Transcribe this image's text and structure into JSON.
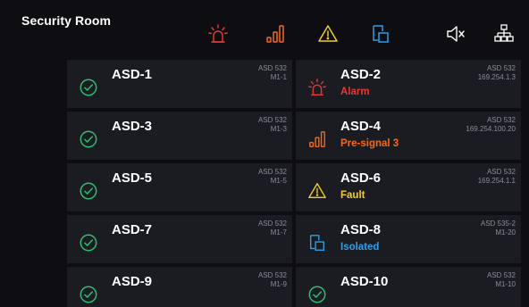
{
  "header": {
    "title": "Security Room",
    "icons": [
      {
        "name": "alarm-icon",
        "color": "#e53935"
      },
      {
        "name": "pre-signal-icon",
        "color": "#f26b1d"
      },
      {
        "name": "fault-icon",
        "color": "#f2d024"
      },
      {
        "name": "isolated-icon",
        "color": "#2f9fe8"
      },
      {
        "name": "mute-speaker-icon",
        "color": "#ffffff"
      },
      {
        "name": "network-icon",
        "color": "#ffffff"
      }
    ]
  },
  "colors": {
    "normal": "#2fbf71",
    "alarm": "#e53935",
    "presignal": "#f26b1d",
    "fault": "#f2d024",
    "isolated": "#2f9fe8"
  },
  "devices": [
    {
      "name": "ASD-1",
      "status": "",
      "status_kind": "normal",
      "model": "ASD 532",
      "address": "M1-1"
    },
    {
      "name": "ASD-2",
      "status": "Alarm",
      "status_kind": "alarm",
      "model": "ASD 532",
      "address": "169.254.1.3"
    },
    {
      "name": "ASD-3",
      "status": "",
      "status_kind": "normal",
      "model": "ASD 532",
      "address": "M1-3"
    },
    {
      "name": "ASD-4",
      "status": "Pre-signal 3",
      "status_kind": "presignal",
      "model": "ASD 532",
      "address": "169.254.100.20"
    },
    {
      "name": "ASD-5",
      "status": "",
      "status_kind": "normal",
      "model": "ASD 532",
      "address": "M1-5"
    },
    {
      "name": "ASD-6",
      "status": "Fault",
      "status_kind": "fault",
      "model": "ASD 532",
      "address": "169.254.1.1"
    },
    {
      "name": "ASD-7",
      "status": "",
      "status_kind": "normal",
      "model": "ASD 532",
      "address": "M1-7"
    },
    {
      "name": "ASD-8",
      "status": "Isolated",
      "status_kind": "isolated",
      "model": "ASD 535-2",
      "address": "M1-20"
    },
    {
      "name": "ASD-9",
      "status": "",
      "status_kind": "normal",
      "model": "ASD 532",
      "address": "M1-9"
    },
    {
      "name": "ASD-10",
      "status": "",
      "status_kind": "normal",
      "model": "ASD 532",
      "address": "M1-10"
    }
  ]
}
